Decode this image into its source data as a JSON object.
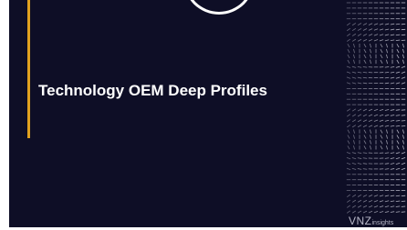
{
  "slide": {
    "title": "Technology OEM Deep Profiles",
    "logo_text_main": "VNZ",
    "logo_text_sub": "insights"
  },
  "colors": {
    "background": "#0e0e26",
    "accent": "#e0a11f",
    "title_text": "#ffffff"
  },
  "icons": [
    "ring-graphic",
    "dash-pattern"
  ]
}
